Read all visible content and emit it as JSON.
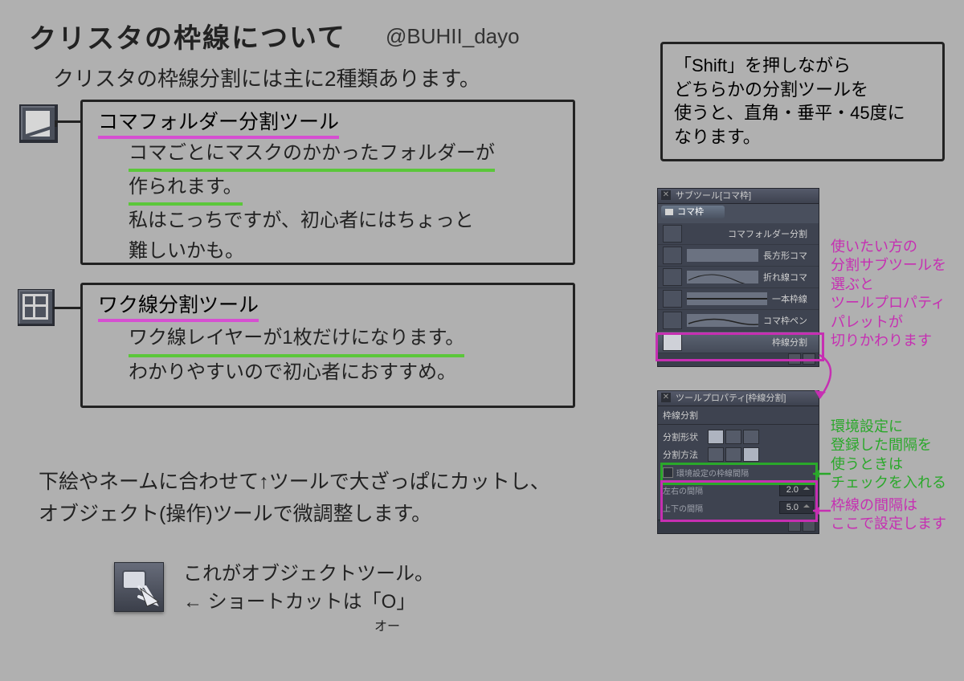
{
  "title": "クリスタの枠線について",
  "twitter": "@BUHII_dayo",
  "intro": "クリスタの枠線分割には主に2種類あります。",
  "tool1": {
    "name": "コマフォルダー分割ツール",
    "line1": "コマごとにマスクのかかったフォルダーが",
    "line2": "作られます。",
    "line3": "私はこっちですが、初心者にはちょっと",
    "line4": "難しいかも。"
  },
  "tool2": {
    "name": "ワク線分割ツール",
    "line1": "ワク線レイヤーが1枚だけになります。",
    "line2": "わかりやすいので初心者におすすめ。"
  },
  "bottom": {
    "line1": "下絵やネームに合わせて↑ツールで大ざっぱにカットし、",
    "line2": "オブジェクト(操作)ツールで微調整します。",
    "obj1": "これがオブジェクトツール。",
    "obj2": "← ショートカットは「O」",
    "obj3": "オー"
  },
  "shiftbox": {
    "l1": "「Shift」を押しながら",
    "l2": "どちらかの分割ツールを",
    "l3": "使うと、直角・垂平・45度に",
    "l4": "なります。"
  },
  "subtool_panel": {
    "title": "サブツール[コマ枠]",
    "tab": "コマ枠",
    "rows": {
      "r1": "コマフォルダー分割",
      "r2": "長方形コマ",
      "r3": "折れ線コマ",
      "r4": "一本枠線",
      "r5": "コマ枠ペン",
      "r6": "枠線分割"
    }
  },
  "prop_panel": {
    "title": "ツールプロパティ[枠線分割]",
    "header": "枠線分割",
    "shape_label": "分割形状",
    "method_label": "分割方法",
    "env_label": "環境設定の枠線間隔",
    "lr_label": "左右の間隔",
    "lr_val": "2.0",
    "tb_label": "上下の間隔",
    "tb_val": "5.0"
  },
  "anno": {
    "select": "使いたい方の\n分割サブツールを\n選ぶと\nツールプロパティ\nパレットが\n切りかわります",
    "env": "環境設定に\n登録した間隔を\n使うときは\nチェックを入れる",
    "gap": "枠線の間隔は\nここで設定します"
  }
}
